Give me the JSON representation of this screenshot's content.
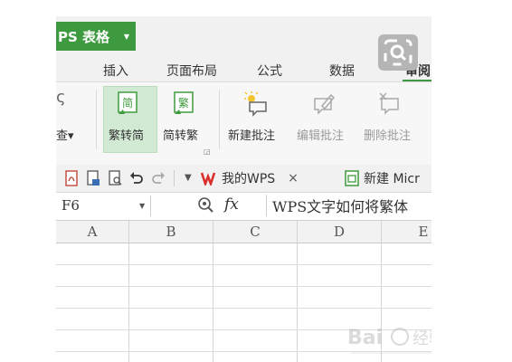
{
  "app": {
    "name": "PS 表格",
    "menu_arrow": "▼"
  },
  "menu": {
    "tabs": [
      {
        "label": "插入"
      },
      {
        "label": "页面布局"
      },
      {
        "label": "公式"
      },
      {
        "label": "数据"
      },
      {
        "label": "审阅"
      }
    ]
  },
  "ribbon": {
    "partial_left_top": "ς",
    "partial_left_label": "查▾",
    "buttons": [
      {
        "label": "繁转简",
        "icon": "simplified-icon",
        "glyph": "简"
      },
      {
        "label": "简转繁",
        "icon": "traditional-icon",
        "glyph": "繁"
      },
      {
        "label": "新建批注",
        "icon": "new-comment-icon"
      },
      {
        "label": "编辑批注",
        "icon": "edit-comment-icon"
      },
      {
        "label": "删除批注",
        "icon": "delete-comment-icon"
      }
    ]
  },
  "quickbar": {
    "doc_tabs": [
      {
        "label": "我的WPS",
        "close": "×"
      },
      {
        "label": "新建 Micr"
      }
    ]
  },
  "formula": {
    "cell_ref": "F6",
    "fx": "fx",
    "content": "WPS文字如何将繁体"
  },
  "grid": {
    "columns": [
      "A",
      "B",
      "C",
      "D",
      "E"
    ]
  },
  "watermark_text": "Baidu 经验"
}
